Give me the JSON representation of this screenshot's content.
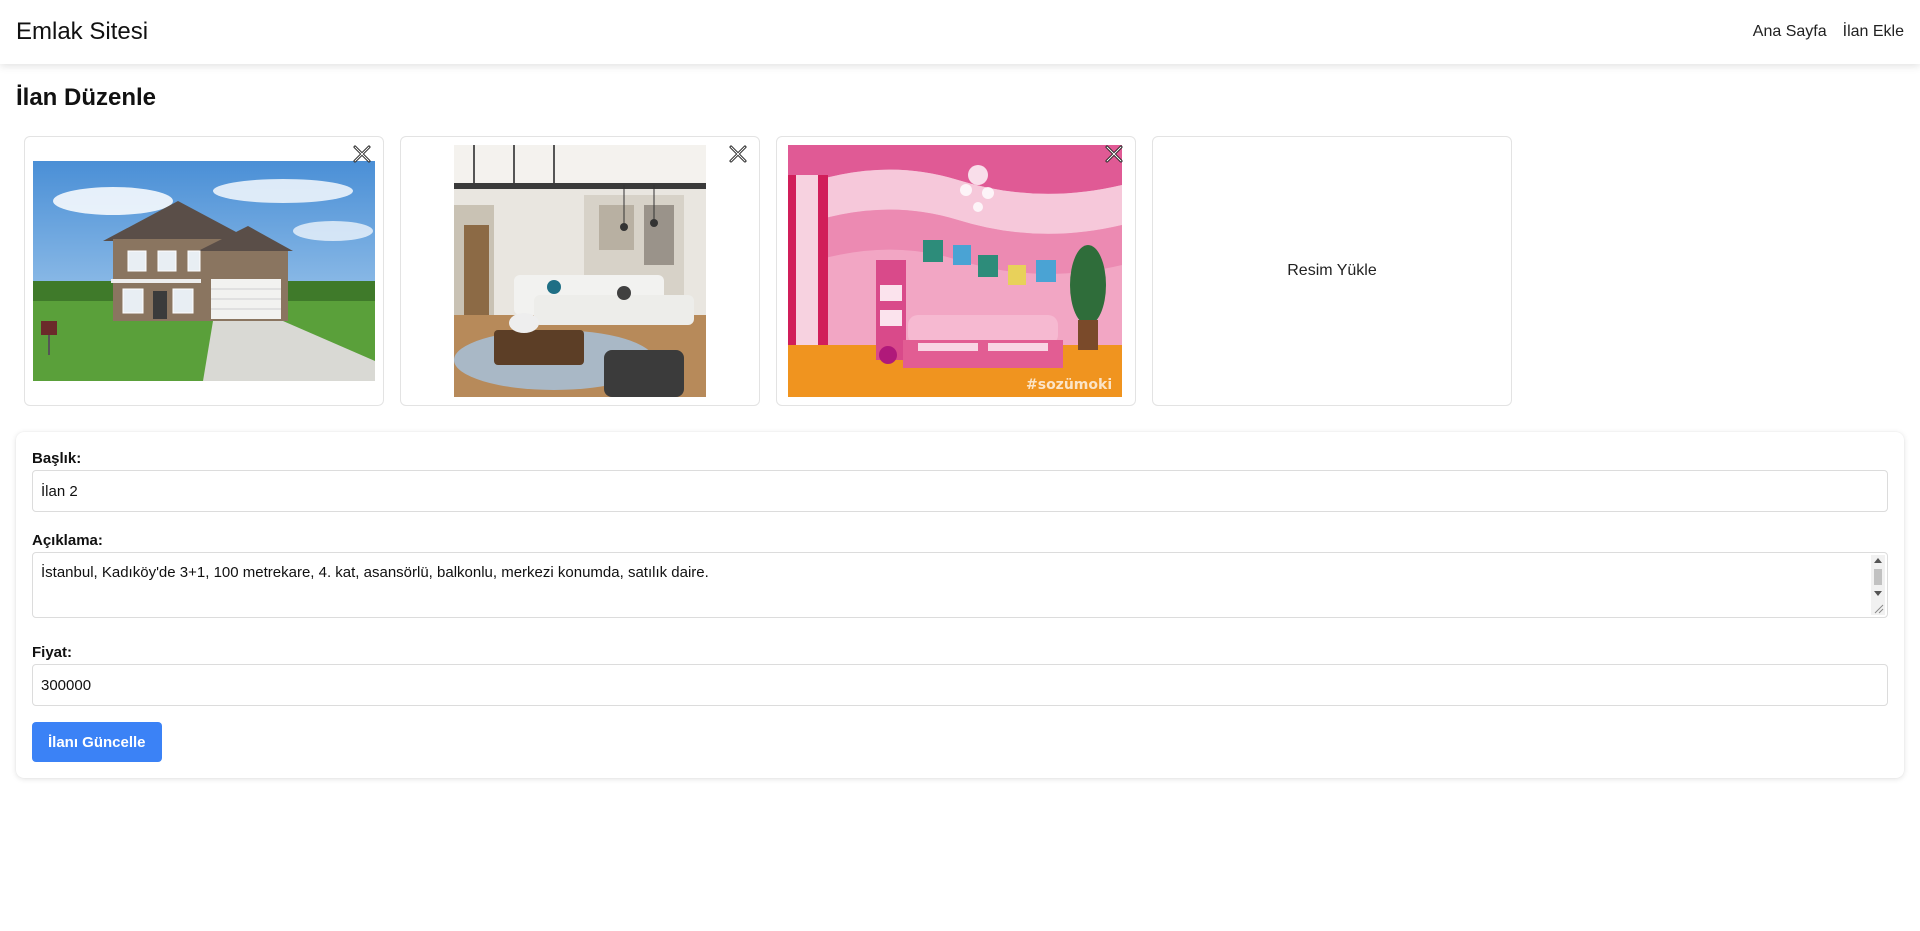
{
  "navbar": {
    "brand": "Emlak Sitesi",
    "links": [
      {
        "label": "Ana Sayfa"
      },
      {
        "label": "İlan Ekle"
      }
    ]
  },
  "page": {
    "title": "İlan Düzenle"
  },
  "gallery": {
    "upload_label": "Resim Yükle",
    "images": [
      {
        "subject": "suburban-house-photo"
      },
      {
        "subject": "living-room-interior-photo"
      },
      {
        "subject": "pink-bedroom-photo",
        "watermark": "#sozümoki"
      }
    ],
    "remove_icon": "close-icon"
  },
  "form": {
    "title_label": "Başlık:",
    "title_value": "İlan 2",
    "description_label": "Açıklama:",
    "description_line1": "İstanbul, Kadıköy'de 3+1, 100 metrekare, 4. kat, asansörlü, balkonlu, merkezi konumda, satılık daire.",
    "price_label": "Fiyat:",
    "price_value": "300000",
    "submit_label": "İlanı Güncelle"
  },
  "colors": {
    "primary_button": "#3b82f6"
  }
}
